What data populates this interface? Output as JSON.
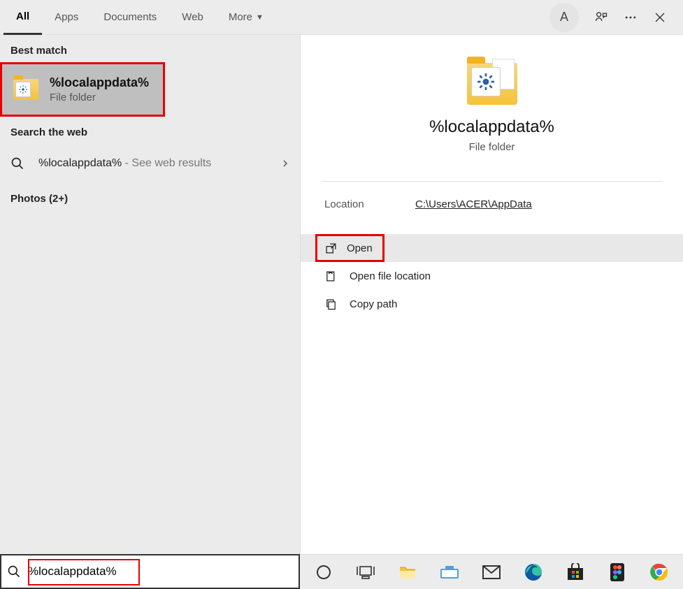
{
  "header": {
    "tabs": [
      {
        "label": "All",
        "active": true
      },
      {
        "label": "Apps",
        "active": false
      },
      {
        "label": "Documents",
        "active": false
      },
      {
        "label": "Web",
        "active": false
      },
      {
        "label": "More",
        "active": false,
        "dropdown": true
      }
    ],
    "avatar_initial": "A"
  },
  "left": {
    "best_match_label": "Best match",
    "best_match": {
      "title": "%localappdata%",
      "subtitle": "File folder"
    },
    "search_web_label": "Search the web",
    "web_result": {
      "query": "%localappdata%",
      "suffix": "- See web results"
    },
    "photos_label": "Photos (2+)"
  },
  "right": {
    "title": "%localappdata%",
    "subtitle": "File folder",
    "location_label": "Location",
    "location_value": "C:\\Users\\ACER\\AppData",
    "actions": [
      {
        "label": "Open",
        "icon": "open-external"
      },
      {
        "label": "Open file location",
        "icon": "file-location"
      },
      {
        "label": "Copy path",
        "icon": "copy"
      }
    ]
  },
  "search": {
    "value": "%localappdata%"
  }
}
